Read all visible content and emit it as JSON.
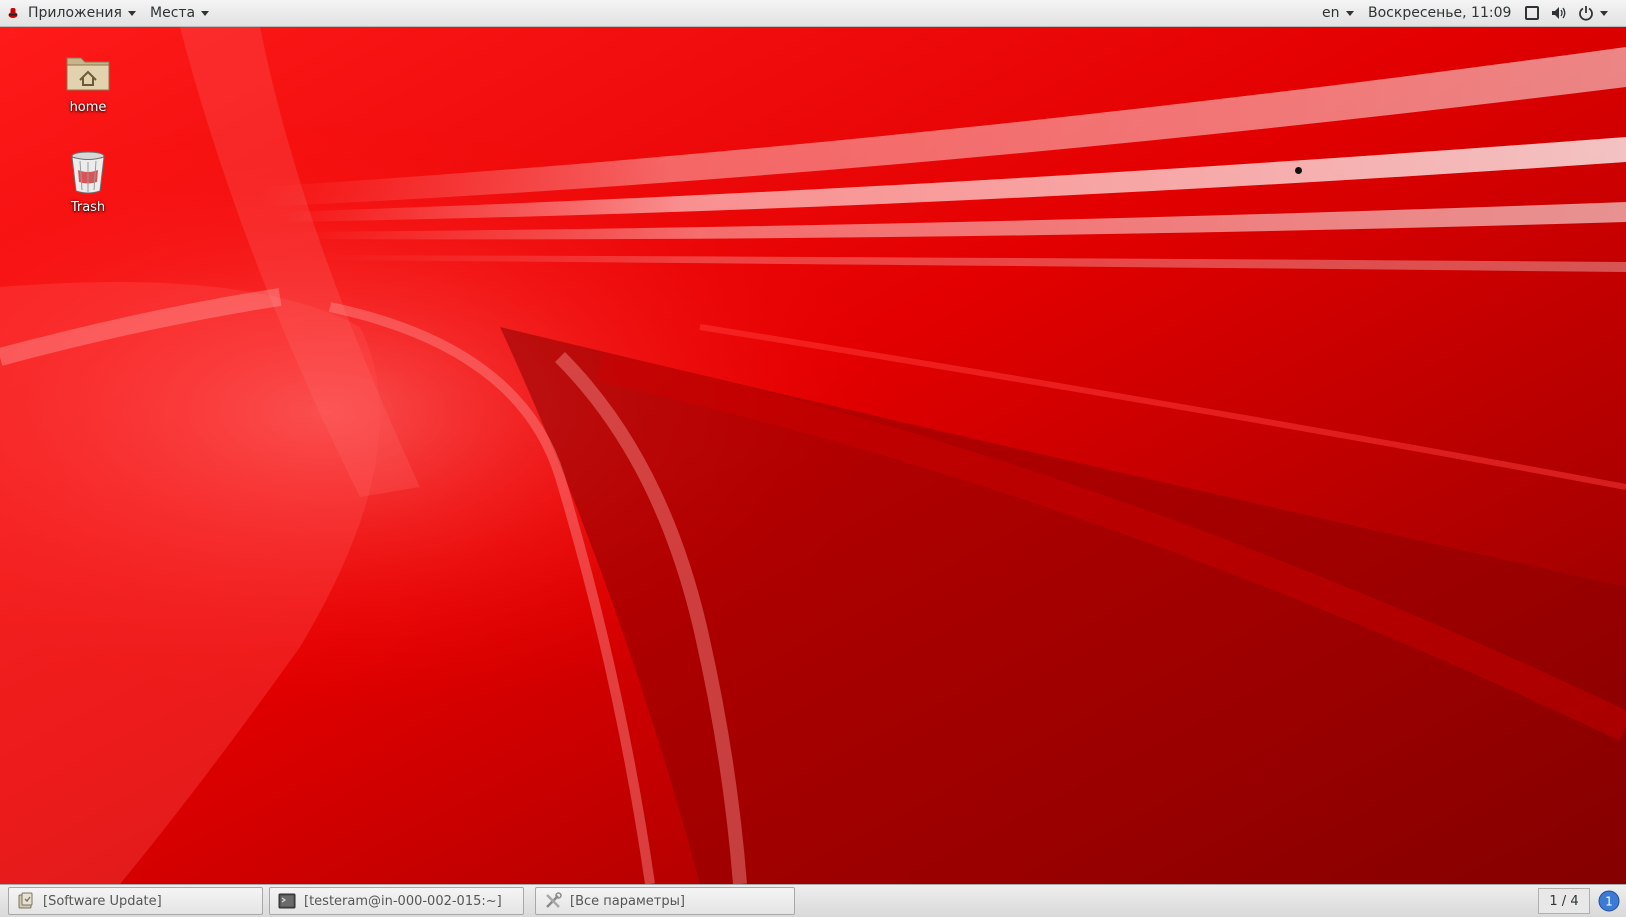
{
  "topbar": {
    "applications_label": "Приложения",
    "places_label": "Места",
    "language": "en",
    "clock": "Воскресенье, 11:09"
  },
  "desktop": {
    "icons": [
      {
        "label": "home",
        "icon": "home-folder-icon"
      },
      {
        "label": "Trash",
        "icon": "trash-icon"
      }
    ]
  },
  "taskbar": {
    "tasks": [
      {
        "label": "[Software Update]",
        "icon": "software-update-icon"
      },
      {
        "label": "[testeram@in-000-002-015:~]",
        "icon": "terminal-icon"
      },
      {
        "label": "[Все параметры]",
        "icon": "settings-tools-icon"
      }
    ],
    "workspace": "1 / 4",
    "notification_count": "1"
  },
  "colors": {
    "wallpaper_base": "#c40000",
    "wallpaper_highlight": "#ff5a5a",
    "panel": "#e6e6e6",
    "notification": "#3b7bd6"
  }
}
